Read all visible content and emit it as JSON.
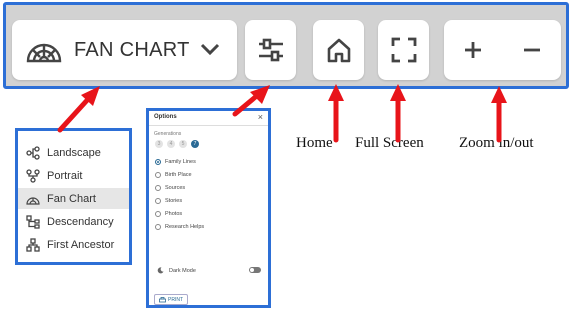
{
  "toolbar": {
    "view_label": "FAN CHART",
    "icons": {
      "view": "fan-chart-icon",
      "dropdown": "chevron-down-icon",
      "options": "sliders-icon",
      "home": "home-icon",
      "fullscreen": "fullscreen-icon",
      "zoom_in": "plus-icon",
      "zoom_out": "minus-icon"
    }
  },
  "view_menu": {
    "items": [
      {
        "label": "Landscape",
        "icon": "landscape-tree-icon",
        "selected": false
      },
      {
        "label": "Portrait",
        "icon": "portrait-tree-icon",
        "selected": false
      },
      {
        "label": "Fan Chart",
        "icon": "fan-chart-icon",
        "selected": true
      },
      {
        "label": "Descendancy",
        "icon": "descendancy-icon",
        "selected": false
      },
      {
        "label": "First Ancestor",
        "icon": "first-ancestor-icon",
        "selected": false
      }
    ]
  },
  "options_panel": {
    "title": "Options",
    "close_glyph": "×",
    "generations_label": "Generations",
    "generations": [
      "3",
      "4",
      "5",
      "7"
    ],
    "generations_selected": "7",
    "radio_items": [
      {
        "label": "Family Lines",
        "checked": true
      },
      {
        "label": "Birth Place",
        "checked": false
      },
      {
        "label": "Sources",
        "checked": false
      },
      {
        "label": "Stories",
        "checked": false
      },
      {
        "label": "Photos",
        "checked": false
      },
      {
        "label": "Research Helps",
        "checked": false
      }
    ],
    "dark_mode_label": "Dark Mode",
    "dark_mode_on": false,
    "print_label": "PRINT"
  },
  "captions": {
    "home": "Home",
    "full_screen": "Full Screen",
    "zoom": "Zoom in/out"
  },
  "colors": {
    "accent_border": "#2d6fd6",
    "arrow": "#e8141a",
    "toolbar_bg": "#d2d2d2",
    "icon": "#444444",
    "selected_gen": "#2a6a95"
  }
}
